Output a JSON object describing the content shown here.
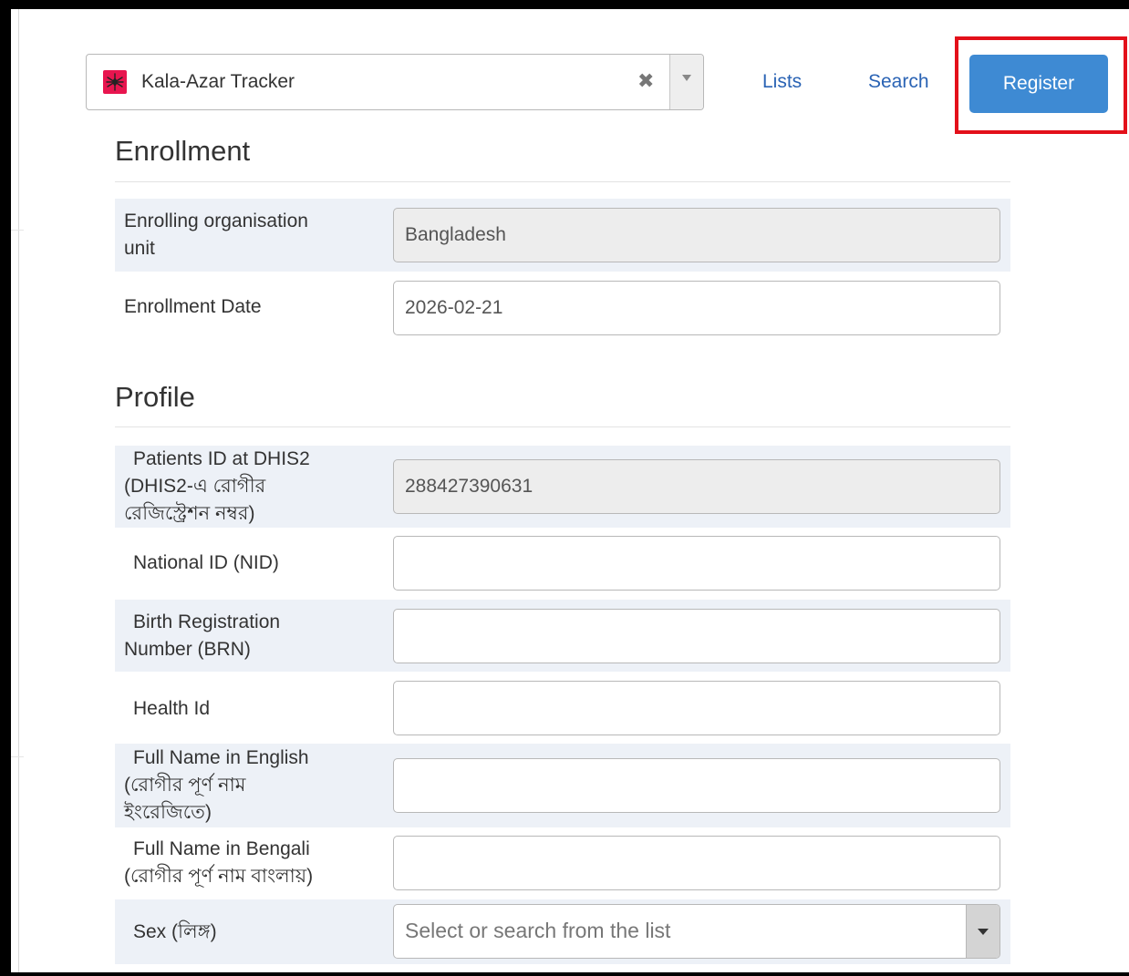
{
  "header": {
    "program": {
      "name": "Kala-Azar Tracker"
    },
    "nav": {
      "lists": "Lists",
      "search": "Search",
      "register": "Register"
    }
  },
  "enrollment": {
    "title": "Enrollment",
    "org_unit": {
      "label_line1": "Enrolling organisation",
      "label_line2": "unit",
      "value": "Bangladesh"
    },
    "date": {
      "label": "Enrollment Date",
      "value": "2026-02-21"
    }
  },
  "profile": {
    "title": "Profile",
    "patient_id": {
      "label_line1": "Patients ID at DHIS2",
      "label_line2": "(DHIS2-এ রোগীর",
      "label_line3": "রেজিস্ট্রেশন নম্বর)",
      "value": "288427390631"
    },
    "nid": {
      "label": "National ID (NID)",
      "value": ""
    },
    "brn": {
      "label_line1": "Birth Registration",
      "label_line2": "Number (BRN)",
      "value": ""
    },
    "health_id": {
      "label": "Health Id",
      "value": ""
    },
    "name_en": {
      "label_line1": "Full Name in English",
      "label_line2": "(রোগীর পূর্ণ নাম",
      "label_line3": "ইংরেজিতে)",
      "value": ""
    },
    "name_bn": {
      "label_line1": "Full Name in Bengali",
      "label_line2": "(রোগীর পূর্ণ নাম বাংলায়)",
      "value": ""
    },
    "sex": {
      "label": "Sex (লিঙ্গ)",
      "placeholder": "Select or search from the list"
    }
  },
  "colors": {
    "accent": "#3e8ad3",
    "link": "#2a63b4",
    "highlight": "#e3101a",
    "row_shade": "#edf1f7",
    "program_icon": "#e8154f"
  },
  "icons": {
    "program": "mosquito-icon",
    "clear": "clear-x-icon",
    "dropdown": "caret-down-icon"
  }
}
